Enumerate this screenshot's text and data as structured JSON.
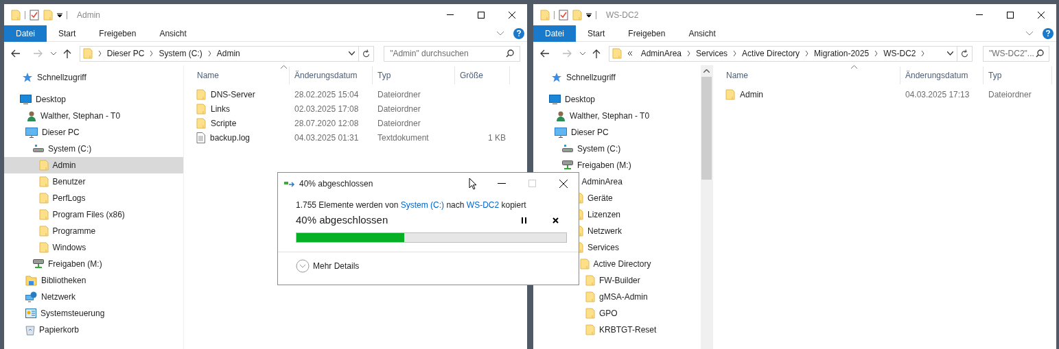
{
  "windows": [
    {
      "title": "Admin",
      "ribbon_tabs": [
        {
          "label": "Datei",
          "selected": true
        },
        {
          "label": "Start",
          "selected": false
        },
        {
          "label": "Freigeben",
          "selected": false
        },
        {
          "label": "Ansicht",
          "selected": false
        }
      ],
      "breadcrumb": [
        "Dieser PC",
        "System (C:)",
        "Admin"
      ],
      "breadcrumb_overflow": false,
      "search": {
        "placeholder": "\"Admin\" durchsuchen"
      },
      "nav": [
        {
          "label": "Schnellzugriff",
          "kind": "star",
          "selected": false
        },
        {
          "label": "Desktop",
          "kind": "desktop",
          "selected": false,
          "children": [
            {
              "label": "Walther, Stephan - T0",
              "kind": "user",
              "selected": false
            },
            {
              "label": "Dieser PC",
              "kind": "pc",
              "selected": false,
              "children": [
                {
                  "label": "System (C:)",
                  "kind": "drive",
                  "selected": false,
                  "children": [
                    {
                      "label": "Admin",
                      "kind": "folder",
                      "selected": true
                    },
                    {
                      "label": "Benutzer",
                      "kind": "folder",
                      "selected": false
                    },
                    {
                      "label": "PerfLogs",
                      "kind": "folder",
                      "selected": false
                    },
                    {
                      "label": "Program Files (x86)",
                      "kind": "folder",
                      "selected": false
                    },
                    {
                      "label": "Programme",
                      "kind": "folder",
                      "selected": false
                    },
                    {
                      "label": "Windows",
                      "kind": "folder",
                      "selected": false
                    }
                  ]
                },
                {
                  "label": "Freigaben (M:)",
                  "kind": "netdrive",
                  "selected": false
                }
              ]
            },
            {
              "label": "Bibliotheken",
              "kind": "library",
              "selected": false
            },
            {
              "label": "Netzwerk",
              "kind": "network",
              "selected": false
            },
            {
              "label": "Systemsteuerung",
              "kind": "control",
              "selected": false
            },
            {
              "label": "Papierkorb",
              "kind": "recycle",
              "selected": false
            }
          ]
        }
      ],
      "columns": [
        "Name",
        "Änderungsdatum",
        "Typ",
        "Größe"
      ],
      "rows": [
        {
          "name": "DNS-Server",
          "kind": "folder",
          "date": "28.02.2025 15:04",
          "type": "Dateiordner"
        },
        {
          "name": "Links",
          "kind": "folder",
          "date": "02.03.2025 17:08",
          "type": "Dateiordner"
        },
        {
          "name": "Scripte",
          "kind": "folder",
          "date": "28.07.2020 12:08",
          "type": "Dateiordner"
        },
        {
          "name": "backup.log",
          "kind": "file",
          "date": "04.03.2025 01:31",
          "type": "Textdokument",
          "size": "1 KB"
        }
      ]
    },
    {
      "title": "WS-DC2",
      "ribbon_tabs": [
        {
          "label": "Datei",
          "selected": true
        },
        {
          "label": "Start",
          "selected": false
        },
        {
          "label": "Freigeben",
          "selected": false
        },
        {
          "label": "Ansicht",
          "selected": false
        }
      ],
      "breadcrumb": [
        "AdminArea",
        "Services",
        "Active Directory",
        "Migration-2025",
        "WS-DC2"
      ],
      "breadcrumb_overflow": true,
      "search": {
        "placeholder": "\"WS-DC2\"..."
      },
      "nav": [
        {
          "label": "Schnellzugriff",
          "kind": "star",
          "selected": false
        },
        {
          "label": "Desktop",
          "kind": "desktop",
          "selected": false,
          "children": [
            {
              "label": "Walther, Stephan - T0",
              "kind": "user",
              "selected": false
            },
            {
              "label": "Dieser PC",
              "kind": "pc",
              "selected": false,
              "children": [
                {
                  "label": "System (C:)",
                  "kind": "drive",
                  "selected": false
                },
                {
                  "label": "Freigaben (M:)",
                  "kind": "netdrive",
                  "selected": false,
                  "children": [
                    {
                      "label": "AdminArea",
                      "kind": "folder",
                      "selected": false,
                      "children": [
                        {
                          "label": "Geräte",
                          "kind": "folder",
                          "selected": false
                        },
                        {
                          "label": "Lizenzen",
                          "kind": "folder",
                          "selected": false
                        },
                        {
                          "label": "Netzwerk",
                          "kind": "folder",
                          "selected": false
                        },
                        {
                          "label": "Services",
                          "kind": "folder",
                          "selected": false,
                          "children": [
                            {
                              "label": "Active Directory",
                              "kind": "folder",
                              "selected": false,
                              "children": [
                                {
                                  "label": "FW-Builder",
                                  "kind": "folder",
                                  "selected": false
                                },
                                {
                                  "label": "gMSA-Admin",
                                  "kind": "folder",
                                  "selected": false
                                },
                                {
                                  "label": "GPO",
                                  "kind": "folder",
                                  "selected": false
                                },
                                {
                                  "label": "KRBTGT-Reset",
                                  "kind": "folder",
                                  "selected": false
                                }
                              ]
                            }
                          ]
                        }
                      ]
                    }
                  ]
                }
              ]
            }
          ]
        }
      ],
      "columns": [
        "Name",
        "Änderungsdatum",
        "Typ"
      ],
      "rows": [
        {
          "name": "Admin",
          "kind": "folder",
          "date": "04.03.2025 17:13",
          "type": "Dateiordner"
        }
      ]
    }
  ],
  "dialog": {
    "title": "40% abgeschlossen",
    "message_parts": [
      "1.755 Elemente werden von ",
      "System (C:)",
      " nach ",
      "WS-DC2",
      " kopiert"
    ],
    "progress_text": "40% abgeschlossen",
    "level": 0.4,
    "details": "Mehr Details"
  }
}
